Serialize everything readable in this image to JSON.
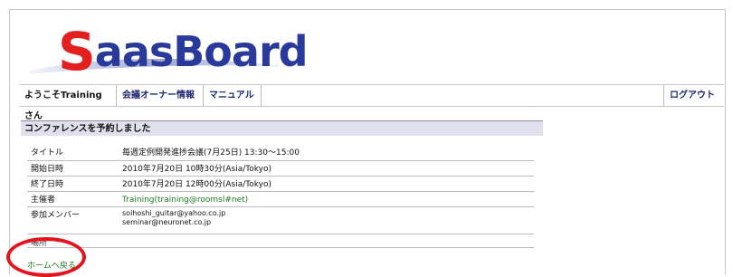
{
  "brand": {
    "logo_initial": "S",
    "logo_rest": "aasBoard",
    "colors": {
      "initial": "#e41f20",
      "rest": "#2a3a9a"
    }
  },
  "nav": {
    "welcome": "ようこそTrainingさん",
    "owner_info": "会議オーナー情報",
    "manual": "マニュアル",
    "logout": "ログアウト"
  },
  "section": {
    "title": "コンファレンスを予約しました"
  },
  "details": {
    "title_label": "タイトル",
    "title_value": "毎週定例開発進捗会議(7月25日) 13:30〜15:00",
    "start_label": "開始日時",
    "start_value": "2010年7月20日 10時30分(Asia/Tokyo)",
    "end_label": "終了日時",
    "end_value": "2010年7月20日 12時00分(Asia/Tokyo)",
    "host_label": "主催者",
    "host_value": "Training(training@roomsl#net)",
    "members_label": "参加メンバー",
    "members": [
      "soihoshi_guitar@yahoo.co.jp",
      "seminar@neuronet.co.jp"
    ],
    "cut_label": "場所"
  },
  "footer": {
    "home_link": "ホームへ戻る"
  },
  "highlight": {
    "color": "#e3141e",
    "target": "home-link"
  }
}
